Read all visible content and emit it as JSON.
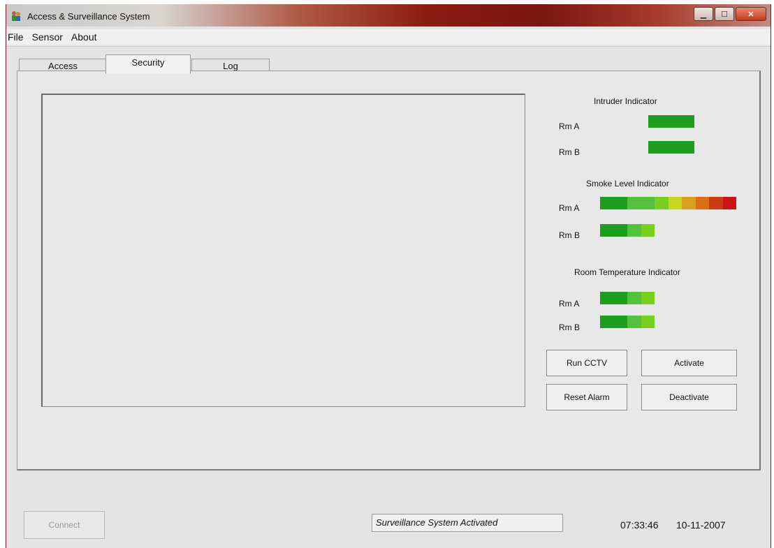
{
  "window": {
    "title": "Access & Surveillance System"
  },
  "menu": [
    "File",
    "Sensor",
    "About"
  ],
  "tabs": [
    "Access",
    "Security",
    "Log"
  ],
  "active_tab": "Security",
  "indicators": {
    "intruder": {
      "title": "Intruder Indicator",
      "rooms": [
        {
          "label": "Rm A",
          "colors": [
            "#1e9e1e"
          ]
        },
        {
          "label": "Rm B",
          "colors": [
            "#1e9e1e"
          ]
        }
      ]
    },
    "smoke": {
      "title": "Smoke Level Indicator",
      "rooms": [
        {
          "label": "Rm A",
          "colors": [
            "#1e9e1e",
            "#1e9e1e",
            "#52c23a",
            "#52c23a",
            "#78d01e",
            "#c8d61e",
            "#dca01e",
            "#dc6e14",
            "#cc3a14",
            "#cc1414"
          ]
        },
        {
          "label": "Rm B",
          "colors": [
            "#1e9e1e",
            "#1e9e1e",
            "#52c23a",
            "#78d01e"
          ]
        }
      ]
    },
    "temperature": {
      "title": "Room Temperature Indicator",
      "rooms": [
        {
          "label": "Rm A",
          "colors": [
            "#1e9e1e",
            "#1e9e1e",
            "#52c23a",
            "#78d01e"
          ]
        },
        {
          "label": "Rm B",
          "colors": [
            "#1e9e1e",
            "#1e9e1e",
            "#52c23a",
            "#78d01e"
          ]
        }
      ]
    }
  },
  "buttons": {
    "run_cctv": "Run CCTV",
    "activate": "Activate",
    "reset_alarm": "Reset Alarm",
    "deactivate": "Deactivate",
    "connect": "Connect"
  },
  "status": {
    "message": "Surveillance System Activated",
    "time": "07:33:46",
    "date": "10-11-2007"
  }
}
